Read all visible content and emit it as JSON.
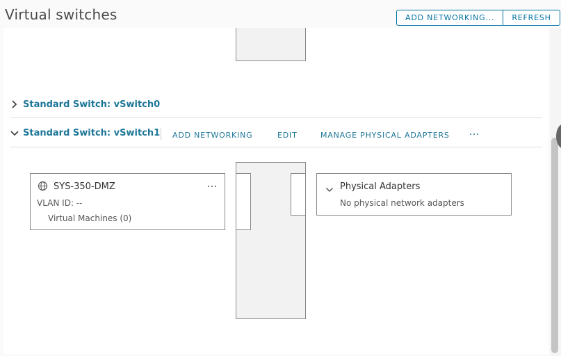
{
  "header": {
    "title": "Virtual switches",
    "add_networking_label": "ADD NETWORKING...",
    "refresh_label": "REFRESH"
  },
  "switches": [
    {
      "title": "Standard Switch: vSwitch0",
      "expanded": false
    },
    {
      "title": "Standard Switch: vSwitch1",
      "expanded": true,
      "actions": {
        "add_networking": "ADD NETWORKING",
        "edit": "EDIT",
        "manage_adapters": "MANAGE PHYSICAL ADAPTERS"
      },
      "port_group": {
        "name": "SYS-350-DMZ",
        "vlan": "VLAN ID: --",
        "vms": "Virtual Machines (0)"
      },
      "physical_adapters": {
        "title": "Physical Adapters",
        "status": "No physical network adapters"
      }
    }
  ],
  "colors": {
    "link": "#1d7698",
    "button_border": "#0072a3",
    "switch_fill": "#f2f2f2"
  },
  "icons": {
    "collapsed": "chevron-right-icon",
    "expanded": "chevron-down-icon",
    "port_group": "globe-network-icon",
    "more": "ellipsis-icon"
  }
}
